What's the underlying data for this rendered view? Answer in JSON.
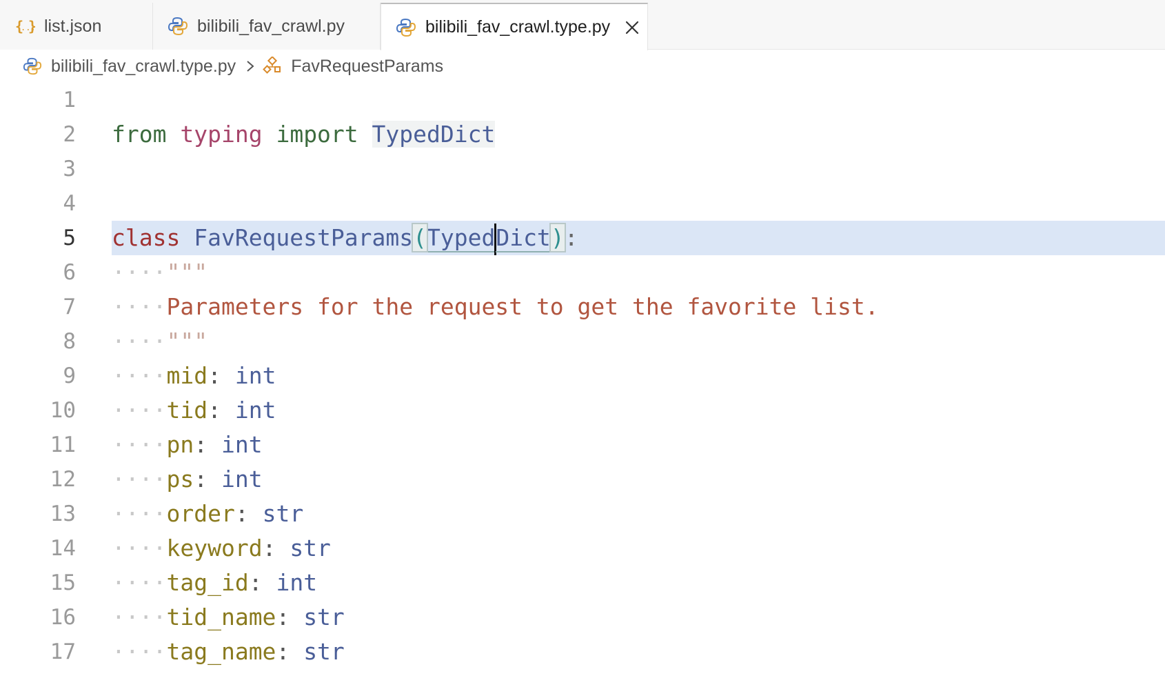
{
  "tabs": [
    {
      "label": "list.json",
      "icon": "json-braces-icon",
      "active": false
    },
    {
      "label": "bilibili_fav_crawl.py",
      "icon": "python-icon",
      "active": false
    },
    {
      "label": "bilibili_fav_crawl.type.py",
      "icon": "python-icon",
      "active": true
    }
  ],
  "breadcrumb": {
    "file": "bilibili_fav_crawl.type.py",
    "symbol": "FavRequestParams"
  },
  "editor": {
    "current_line": 5,
    "line_numbers": [
      "1",
      "2",
      "3",
      "4",
      "5",
      "6",
      "7",
      "8",
      "9",
      "10",
      "11",
      "12",
      "13",
      "14",
      "15",
      "16",
      "17"
    ],
    "code": {
      "from_kw": "from",
      "module": "typing",
      "import_kw": "import",
      "imported": "TypedDict",
      "class_kw": "class",
      "class_name": "FavRequestParams",
      "open_paren": "(",
      "base_left": "Typed",
      "base_right": "Dict",
      "close_paren": ")",
      "class_colon": ":",
      "indent_dots": "····",
      "doc_quote": "\"\"\"",
      "doc_text": "Parameters for the request to get the favorite list.",
      "fields": [
        {
          "name": "mid",
          "type": "int"
        },
        {
          "name": "tid",
          "type": "int"
        },
        {
          "name": "pn",
          "type": "int"
        },
        {
          "name": "ps",
          "type": "int"
        },
        {
          "name": "order",
          "type": "str"
        },
        {
          "name": "keyword",
          "type": "str"
        },
        {
          "name": "tag_id",
          "type": "int"
        },
        {
          "name": "tid_name",
          "type": "str"
        },
        {
          "name": "tag_name",
          "type": "str"
        }
      ],
      "field_colon": ": "
    }
  },
  "colors": {
    "current_line_bg": "#dbe6f6",
    "keyword_from": "#3c6b3e",
    "keyword_class": "#a03232",
    "module": "#a6456a",
    "type": "#4a5e98",
    "docstring": "#b1553f",
    "field": "#8a7a1e",
    "json_icon": "#d99a2b",
    "python_blue": "#4a78c2",
    "python_yellow": "#e3a73a"
  }
}
